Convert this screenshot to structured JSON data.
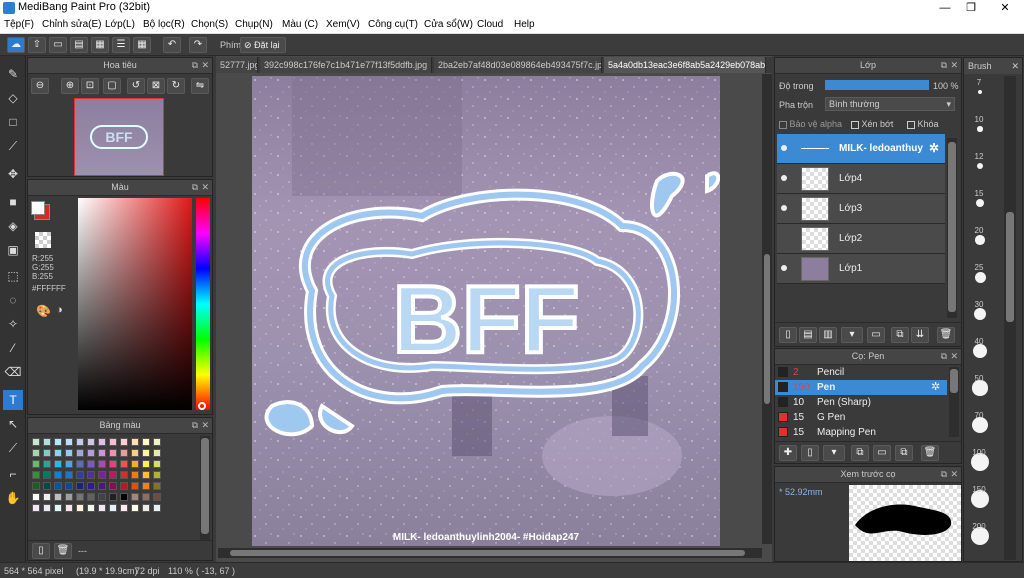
{
  "window": {
    "title": "MediBang Paint Pro (32bit)",
    "minimize": "—",
    "maximize": "❐",
    "close": "✕"
  },
  "menu": [
    "Tệp(F)",
    "Chỉnh sửa(E)",
    "Lớp(L)",
    "Bộ lọc(R)",
    "Chọn(S)",
    "Chụp(N)",
    "Màu (C)",
    "Xem(V)",
    "Công cụ(T)",
    "Cửa sổ(W)",
    "Cloud",
    "Help"
  ],
  "toolbar": {
    "shortcut_label": "Phím",
    "reset_label": "Đặt lại"
  },
  "navigator": {
    "title": "Hoa tiêu"
  },
  "color": {
    "title": "Màu",
    "r": "R:255",
    "g": "G:255",
    "b": "B:255",
    "hex": "#FFFFFF"
  },
  "palette": {
    "title": "Bảng màu",
    "footer": "---"
  },
  "tabs": [
    "52777.jpg",
    "392c998c176fe7c1b471e77f13f5ddfb.jpg",
    "2ba2eb7af48d03e089864eb493475f7c.jpg",
    "5a4a0db13eac3e6f8ab5a2429eb078ab.jpg"
  ],
  "artwork": {
    "title": "BFF",
    "watermark": "MILK- ledoanthuylinh2004- #Hoidap247"
  },
  "layers": {
    "title": "Lớp",
    "opacity_label": "Độ trong",
    "opacity_value": "100 %",
    "opacity": 1.0,
    "blend_label": "Pha trộn",
    "blend_value": "Bình thường",
    "protect_alpha": "Bảo vệ alpha",
    "clipping": "Xén bớt",
    "lock": "Khóa",
    "items": [
      {
        "name": "MILK- ledoanthuy",
        "selected": true
      },
      {
        "name": "Lớp4",
        "selected": false
      },
      {
        "name": "Lớp3",
        "selected": false
      },
      {
        "name": "Lớp2",
        "selected": false
      },
      {
        "name": "Lớp1",
        "selected": false
      }
    ]
  },
  "brush_panel": {
    "title": "Cọ: Pen",
    "items": [
      {
        "size": "2",
        "name": "Pencil",
        "color": "#222222"
      },
      {
        "size": "150",
        "name": "Pen",
        "color": "#222222",
        "selected": true
      },
      {
        "size": "10",
        "name": "Pen (Sharp)",
        "color": "#222222"
      },
      {
        "size": "15",
        "name": "G Pen",
        "color": "#e03030"
      },
      {
        "size": "15",
        "name": "Mapping Pen",
        "color": "#e03030"
      }
    ]
  },
  "preview": {
    "title": "Xem trước cọ",
    "size": "52.92mm"
  },
  "brush_sizes": {
    "title": "Brush",
    "sizes": [
      "7",
      "10",
      "12",
      "15",
      "20",
      "25",
      "30",
      "40",
      "50",
      "70",
      "100",
      "150",
      "200"
    ]
  },
  "status": {
    "dims": "564 * 564 pixel",
    "cm": "(19.9 * 19.9cm)",
    "dpi": "72 dpi",
    "zoom": "110 %",
    "coords": "( -13, 67 )"
  },
  "colors": {
    "accent": "#3d8ad4",
    "fg": "#ffffff",
    "bg": "#d42a2a"
  }
}
